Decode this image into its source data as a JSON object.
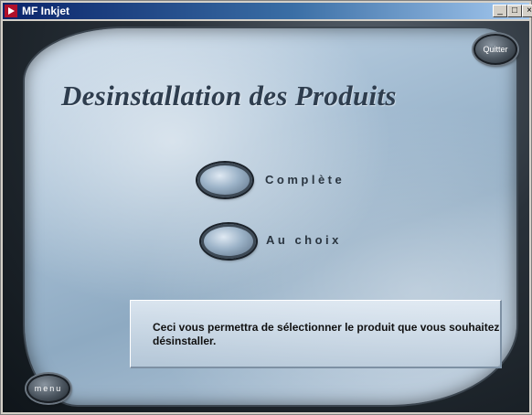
{
  "window": {
    "title": "MF Inkjet",
    "controls": {
      "minimize": "_",
      "maximize": "□",
      "close": "×"
    }
  },
  "header": {
    "title": "Desinstallation des Produits"
  },
  "options": [
    {
      "label": "Complète"
    },
    {
      "label": "Au choix"
    }
  ],
  "info": {
    "text": "Ceci vous permettra de sélectionner le produit que vous souhaitez désinstaller."
  },
  "buttons": {
    "quit": "Quitter",
    "menu": "menu"
  },
  "colors": {
    "titlebar": "#0a246a",
    "accent": "#2e3d4e"
  }
}
